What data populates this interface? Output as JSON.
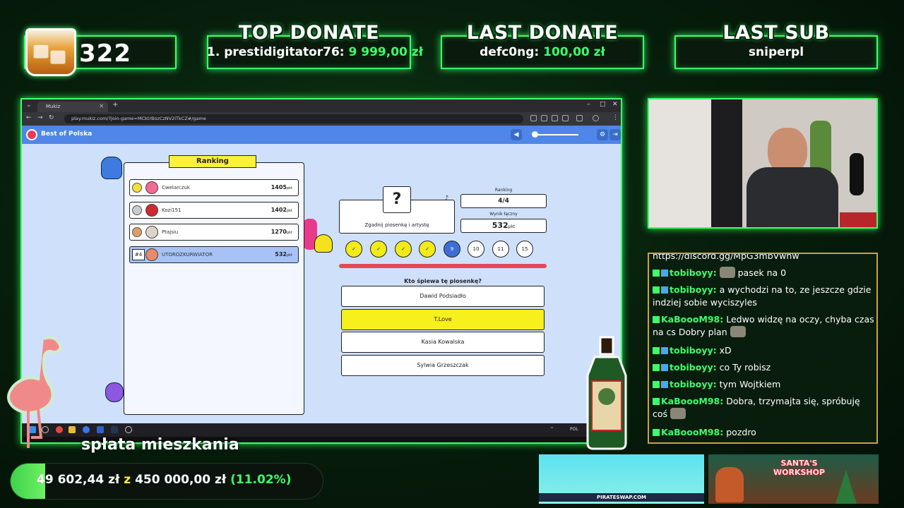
{
  "overlay": {
    "counter": "322",
    "top_donate": {
      "title": "TOP DONATE",
      "name": "1. prestidigitator76:",
      "amount": "9 999,00 zł"
    },
    "last_donate": {
      "title": "LAST DONATE",
      "name": "defc0ng:",
      "amount": "100,00 zł"
    },
    "last_sub": {
      "title": "LAST SUB",
      "name": "sniperpl"
    },
    "goal": {
      "label": "spłata mieszkania",
      "current": "49 602,44 zł",
      "sep": "z",
      "target": "450 000,00 zł",
      "percent_text": "(11.02%)",
      "progress": 0.1102
    },
    "sponsor1": "PIRATESWAP.COM",
    "sponsor2_line1": "SANTA'S",
    "sponsor2_line2": "WORKSHOP"
  },
  "browser": {
    "tab_title": "Mukiz",
    "url": "play.mukiz.com/?join-game=MCktrBozCzNV2iTkCZ#/game",
    "app_title": "Best of Polska",
    "taskbar_lang": "POL"
  },
  "game": {
    "ranking_title": "Ranking",
    "players": [
      {
        "name": "Cwelarczuk",
        "score": "1405",
        "unit": "pkt"
      },
      {
        "name": "Kozi151",
        "score": "1402",
        "unit": "pkt"
      },
      {
        "name": "Ptajsiu",
        "score": "1270",
        "unit": "pkt"
      },
      {
        "rank": "#4",
        "name": "UTOROZKURWIATOR",
        "score": "532",
        "unit": "pkt"
      }
    ],
    "question_mark": "?",
    "question_card_label": "Zgadnij piosenkę i artystę",
    "ranking_label": "Ranking",
    "ranking_value": "4/4",
    "total_label": "Wynik łączny",
    "total_value": "532",
    "total_unit": "pkt",
    "rounds": [
      "✓",
      "✓",
      "✓",
      "✓",
      "9",
      "10",
      "11",
      "15"
    ],
    "question": "Kto śpiewa tę piosenkę?",
    "answers": [
      "Dawid Podsiadło",
      "T.Love",
      "Kasia Kowalska",
      "Sylwia Grzeszczak"
    ],
    "selected_answer": 1
  },
  "chat": [
    {
      "user": "",
      "text": "https://discord.gg/MpG3mbVwnw"
    },
    {
      "user": "tobiboyy:",
      "text": "pasek na 0"
    },
    {
      "user": "tobiboyy:",
      "text": "a wychodzi na to, ze jeszcze gdzie indziej sobie wyciszyles"
    },
    {
      "user": "KaBoooM98:",
      "text": "Ledwo widzę na oczy, chyba czas na cs Dobry plan"
    },
    {
      "user": "tobiboyy:",
      "text": "xD"
    },
    {
      "user": "tobiboyy:",
      "text": "co Ty robisz"
    },
    {
      "user": "tobiboyy:",
      "text": "tym Wojtkiem"
    },
    {
      "user": "KaBoooM98:",
      "text": "Dobra, trzymajta się, spróbuję coś"
    },
    {
      "user": "KaBoooM98:",
      "text": "pozdro"
    }
  ]
}
